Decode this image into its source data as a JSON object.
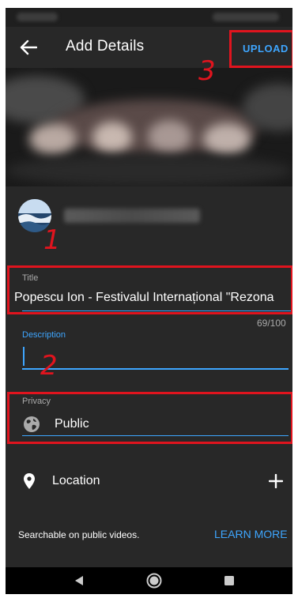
{
  "app_bar": {
    "title": "Add Details",
    "upload_label": "UPLOAD"
  },
  "icons": {
    "back": "arrow-back-icon",
    "privacy": "globe-icon",
    "location": "location-pin-icon",
    "add_location": "plus-icon",
    "nav_back": "nav-back-triangle-icon",
    "nav_home": "nav-home-circle-icon",
    "nav_recents": "nav-recents-square-icon"
  },
  "form": {
    "title": {
      "label": "Title",
      "value": "Popescu Ion - Festivalul Internațional \"Rezona",
      "char_count": "69/100"
    },
    "description": {
      "label": "Description",
      "value": ""
    },
    "privacy": {
      "label": "Privacy",
      "value": "Public"
    },
    "location": {
      "label": "Location"
    }
  },
  "footer": {
    "searchable_text": "Searchable on public videos.",
    "learn_more": "LEARN MORE"
  },
  "annotations": {
    "one": "1",
    "two": "2",
    "three": "3"
  },
  "colors": {
    "background": "#282828",
    "accent": "#3ea6ff",
    "annotation": "#e0141e"
  }
}
